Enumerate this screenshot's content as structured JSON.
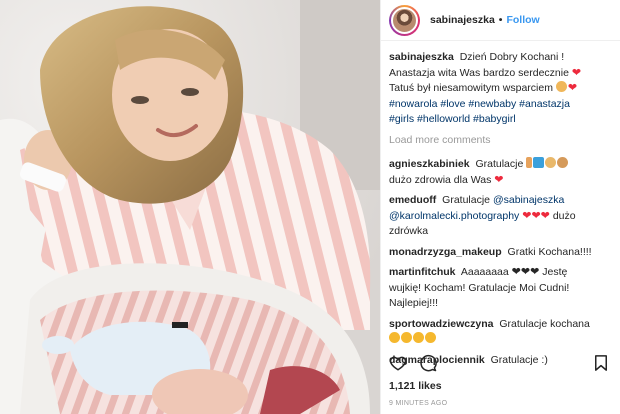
{
  "post": {
    "owner": "sabinajeszka",
    "separator": "•",
    "follow_label": "Follow"
  },
  "caption": {
    "user": "sabinajeszka",
    "line1": "Dzień Dobry Kochani !",
    "line2": "Anastazja wita Was bardzo serdecznie",
    "line3": "Tatuś był niesamowitym wsparciem",
    "hashtags1": "#nowarola #love #newbaby #anastazja",
    "hashtags2": "#girls #helloworld #babygirl"
  },
  "load_more": "Load more comments",
  "comments": [
    {
      "user": "agnieszkabiniek",
      "text": "Gratulacje",
      "text2": "dużo zdrowia dla Was"
    },
    {
      "user": "emeduoff",
      "text": "Gratulacje",
      "mention1": "@sabinajeszka",
      "mention2": "@karolmalecki.photography",
      "text2": "dużo",
      "text3": "zdrówka"
    },
    {
      "user": "monadrzyzga_makeup",
      "text": "Gratki Kochana!!!!"
    },
    {
      "user": "martinfitchuk",
      "text": "Aaaaaaaa",
      "text2": "Jestę",
      "text3": "wujkię! Kocham! Gratulacje Moi Cudni!",
      "text4": "Najlepiej!!!"
    },
    {
      "user": "sportowadziewczyna",
      "text": "Gratulacje kochana"
    },
    {
      "user": "dagmaraplociennik",
      "text": "Gratulacje :)"
    }
  ],
  "likes": "1,121 likes",
  "time_ago": "9 MINUTES AGO",
  "icons": {
    "like": "heart-outline-icon",
    "comment": "speech-bubble-icon",
    "save": "bookmark-icon"
  },
  "colors": {
    "link": "#3897f0",
    "hashtag": "#003569",
    "heart": "#ed2a3d",
    "muted": "#999999"
  }
}
